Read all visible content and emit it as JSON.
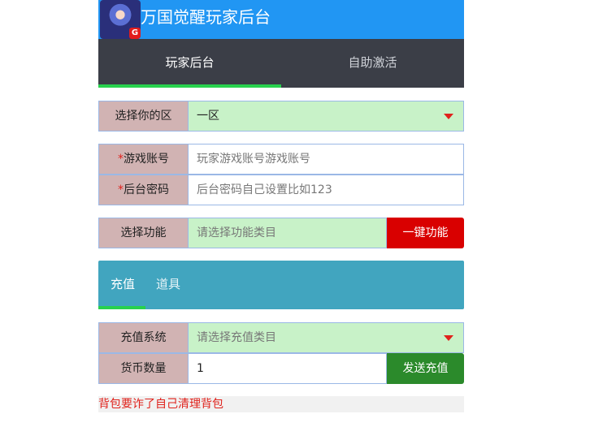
{
  "header": {
    "title": "万国觉醒玩家后台",
    "logo_badge": "G"
  },
  "tabs": [
    {
      "label": "玩家后台",
      "active": true
    },
    {
      "label": "自助激活",
      "active": false
    }
  ],
  "form": {
    "zone": {
      "label": "选择你的区",
      "value": "一区"
    },
    "account": {
      "required_mark": "*",
      "label": "游戏账号",
      "placeholder": "玩家游戏账号游戏账号"
    },
    "password": {
      "required_mark": "*",
      "label": "后台密码",
      "placeholder": "后台密码自己设置比如123"
    },
    "function": {
      "label": "选择功能",
      "placeholder": "请选择功能类目",
      "button": "一键功能"
    }
  },
  "subtabs": [
    {
      "label": "充值",
      "active": true
    },
    {
      "label": "道具",
      "active": false
    }
  ],
  "recharge": {
    "system": {
      "label": "充值系统",
      "placeholder": "请选择充值类目"
    },
    "amount": {
      "label": "货币数量",
      "value": "1",
      "button": "发送充值"
    }
  },
  "notice": "背包要诈了自己清理背包",
  "colors": {
    "header_bg": "#2196f3",
    "tabs_bg": "#3b3e47",
    "indicator": "#28d14d",
    "label_bg": "#d1b3b3",
    "field_green": "#c8f2c8",
    "subtabs_bg": "#41a5bf",
    "danger": "#d90000",
    "success": "#2b8a2b"
  }
}
